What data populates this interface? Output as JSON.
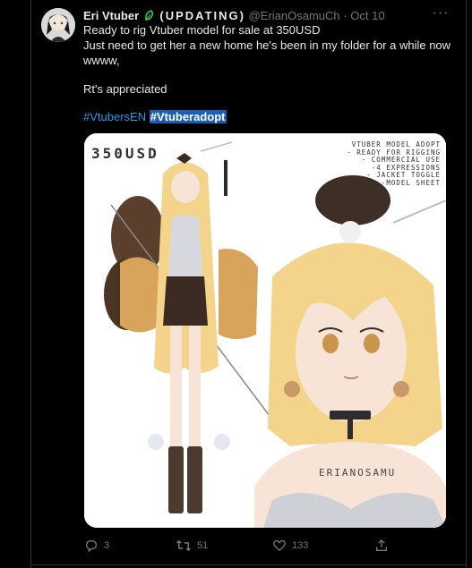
{
  "tweet": {
    "display_name": "Eri Vtuber",
    "name_suffix": "(UPDATING)",
    "handle": "@ErianOsamuCh",
    "separator": "·",
    "date": "Oct 10",
    "more_label": "···",
    "lines": [
      "Ready to rig Vtuber model for sale at 350USD",
      "Just need to get her a new home he's been in my folder for a while now",
      "wwww,",
      "Rt's appreciated"
    ],
    "hashtags": [
      "#VtubersEN",
      "#Vtuberadopt"
    ]
  },
  "media": {
    "price": "350USD",
    "specs": [
      "VTUBER MODEL ADOPT",
      "- READY FOR RIGGING",
      "- COMMERCIAL USE",
      "-4 EXPRESSIONS",
      "- JACKET TOGGLE",
      "-MODEL SHEET"
    ],
    "signature": "ERIANOSAMU"
  },
  "actions": {
    "replies": "3",
    "retweets": "51",
    "likes": "133"
  },
  "colors": {
    "background": "#000000",
    "text": "#e7e9ea",
    "muted": "#71767b",
    "link": "#1d9bf0",
    "border": "#2f3336"
  }
}
